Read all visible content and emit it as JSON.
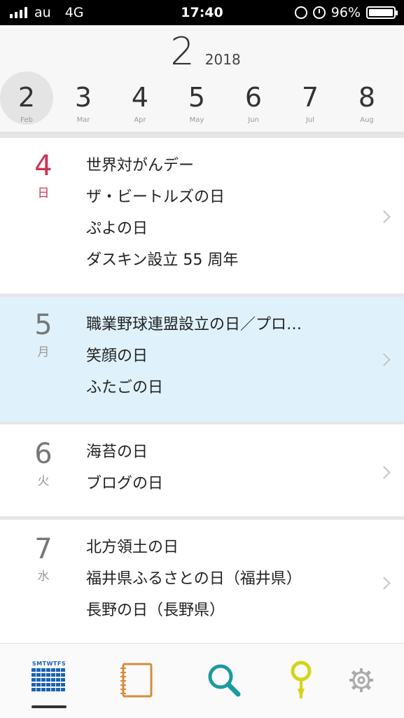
{
  "status_bar": {
    "carrier": "au",
    "network": "4G",
    "time": "17:40",
    "battery": "96%"
  },
  "header": {
    "current_month": "2",
    "current_year": "2018",
    "months": [
      {
        "num": "2",
        "abbr": "Feb",
        "selected": true
      },
      {
        "num": "3",
        "abbr": "Mar"
      },
      {
        "num": "4",
        "abbr": "Apr"
      },
      {
        "num": "5",
        "abbr": "May"
      },
      {
        "num": "6",
        "abbr": "Jun"
      },
      {
        "num": "7",
        "abbr": "Jul"
      },
      {
        "num": "8",
        "abbr": "Aug"
      }
    ]
  },
  "days": [
    {
      "date": "4",
      "weekday": "日",
      "events": [
        "世界対がんデー",
        "ザ・ビートルズの日",
        "ぷよの日",
        "ダスキン設立 55 周年"
      ]
    },
    {
      "date": "5",
      "weekday": "月",
      "events": [
        "職業野球連盟設立の日／プロ…",
        "笑顔の日",
        "ふたごの日"
      ]
    },
    {
      "date": "6",
      "weekday": "火",
      "events": [
        "海苔の日",
        "ブログの日"
      ]
    },
    {
      "date": "7",
      "weekday": "水",
      "events": [
        "北方領土の日",
        "福井県ふるさとの日（福井県）",
        "長野の日（長野県）"
      ]
    }
  ],
  "tabbar": {
    "calendar_header": "SMTWTFS",
    "icons": [
      "calendar-icon",
      "notebook-icon",
      "search-icon",
      "map-pin-icon",
      "gear-icon"
    ],
    "colors": {
      "calendar": "#1a63b0",
      "notebook": "#d98a3a",
      "search": "#1b9aa0",
      "pin": "#d4d41a",
      "gear": "#aaaaaa"
    }
  }
}
